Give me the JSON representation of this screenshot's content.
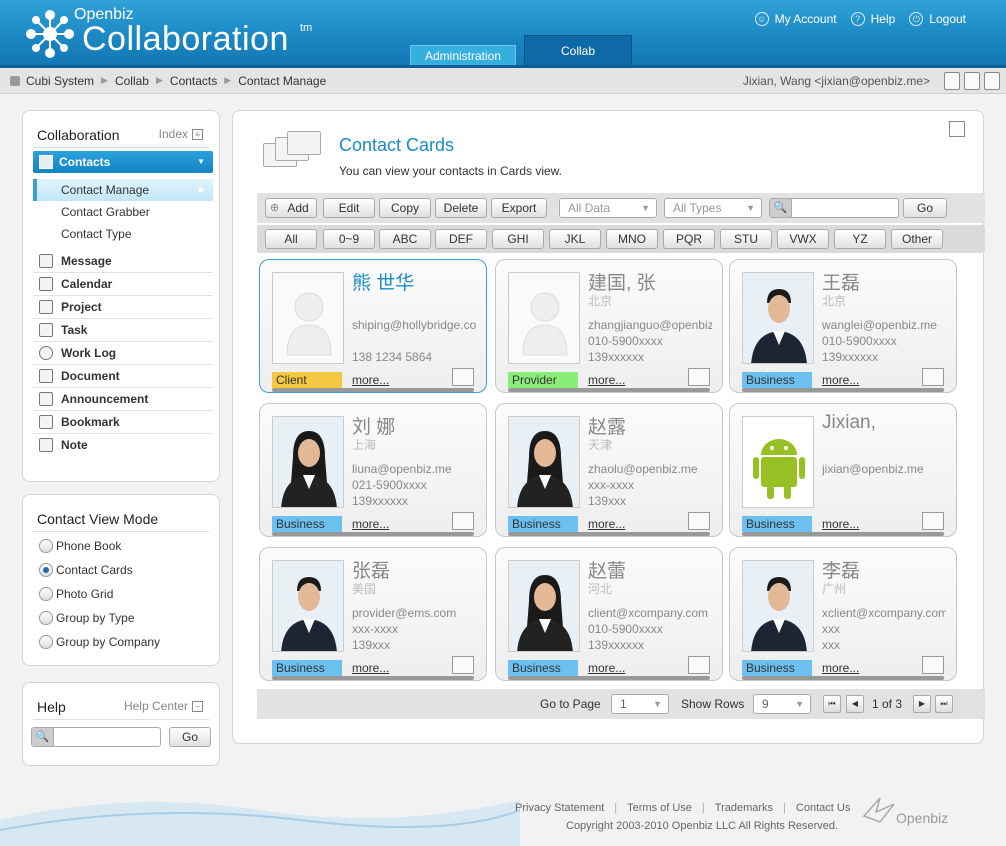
{
  "header": {
    "logo_top": "Openbiz",
    "logo_main": "Collaboration",
    "logo_tm": "tm",
    "links": [
      "My Account",
      "Help",
      "Logout"
    ],
    "tabs": [
      "Administration",
      "Collab"
    ]
  },
  "breadcrumb": [
    "Cubi System",
    "Collab",
    "Contacts",
    "Contact Manage"
  ],
  "user": "Jixian, Wang <jixian@openbiz.me>",
  "sidebar": {
    "title": "Collaboration",
    "index_label": "Index",
    "active_section": "Contacts",
    "sub_items": [
      "Contact Manage",
      "Contact Grabber",
      "Contact Type"
    ],
    "items": [
      "Message",
      "Calendar",
      "Project",
      "Task",
      "Work Log",
      "Document",
      "Announcement",
      "Bookmark",
      "Note"
    ]
  },
  "view_mode": {
    "title": "Contact View Mode",
    "options": [
      "Phone Book",
      "Contact Cards",
      "Photo Grid",
      "Group by Type",
      "Group by Company"
    ],
    "selected": "Contact Cards"
  },
  "help": {
    "title": "Help",
    "link": "Help Center",
    "go": "Go"
  },
  "main": {
    "title": "Contact Cards",
    "desc": "You can view your contacts in Cards view.",
    "toolbar": {
      "add": "Add",
      "edit": "Edit",
      "copy": "Copy",
      "delete": "Delete",
      "export": "Export",
      "filter_data": "All Data",
      "filter_types": "All Types",
      "go": "Go"
    },
    "alpha": [
      "All",
      "0~9",
      "ABC",
      "DEF",
      "GHI",
      "JKL",
      "MNO",
      "PQR",
      "STU",
      "VWX",
      "YZ",
      "Other"
    ],
    "cards": [
      {
        "name": "熊 世华",
        "city": "",
        "email": "shiping@hollybridge.com",
        "phone": "138 1234 5864",
        "mobile": "",
        "type": "Client",
        "more": "more..."
      },
      {
        "name": "建国, 张",
        "city": "北京",
        "email": "zhangjianguo@openbiz.me",
        "phone": "010-5900xxxx",
        "mobile": "139xxxxxx",
        "type": "Provider",
        "more": "more..."
      },
      {
        "name": "王磊",
        "city": "北京",
        "email": "wanglei@openbiz.me",
        "phone": "010-5900xxxx",
        "mobile": "139xxxxxx",
        "type": "Business",
        "more": "more..."
      },
      {
        "name": "刘 娜",
        "city": "上海",
        "email": "liuna@openbiz.me",
        "phone": "021-5900xxxx",
        "mobile": "139xxxxxx",
        "type": "Business",
        "more": "more..."
      },
      {
        "name": "赵露",
        "city": "天津",
        "email": "zhaolu@openbiz.me",
        "phone": "xxx-xxxx",
        "mobile": "139xxx",
        "type": "Business",
        "more": "more..."
      },
      {
        "name": "Jixian,",
        "city": "",
        "email": "jixian@openbiz.me",
        "phone": "",
        "mobile": "",
        "type": "Business",
        "more": "more..."
      },
      {
        "name": "张磊",
        "city": "美国",
        "email": "provider@ems.com",
        "phone": "xxx-xxxx",
        "mobile": "139xxx",
        "type": "Business",
        "more": "more..."
      },
      {
        "name": "赵蕾",
        "city": "河北",
        "email": "client@xcompany.com",
        "phone": "010-5900xxxx",
        "mobile": "139xxxxxx",
        "type": "Business",
        "more": "more..."
      },
      {
        "name": "李磊",
        "city": "广州",
        "email": "xclient@xcompany.com",
        "phone": "xxx",
        "mobile": "xxx",
        "type": "Business",
        "more": "more..."
      }
    ],
    "pager": {
      "goto_label": "Go to Page",
      "page": "1",
      "rows_label": "Show Rows",
      "rows": "9",
      "status": "1 of 3"
    }
  },
  "footer": {
    "links": [
      "Privacy Statement",
      "Terms of Use",
      "Trademarks",
      "Contact Us"
    ],
    "copyright": "Copyright 2003-2010 Openbiz LLC All Rights Reserved.",
    "logo": "Openbiz"
  },
  "colors": {
    "header": "#1a86c2",
    "client": "#f5c842",
    "provider": "#88ee77",
    "business": "#6cc0f0",
    "link": "#1a8ac8"
  }
}
